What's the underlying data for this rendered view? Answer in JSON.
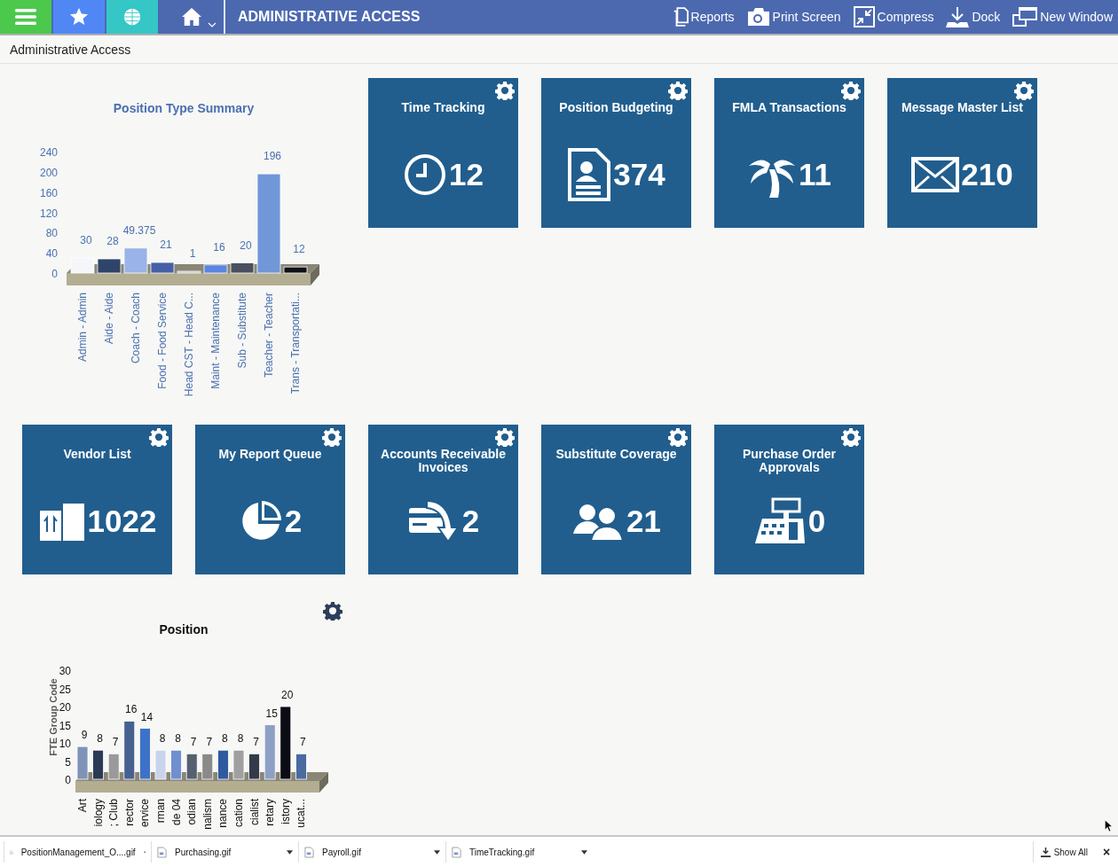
{
  "app_bar": {
    "title": "ADMINISTRATIVE ACCESS",
    "actions": [
      {
        "label": "Reports"
      },
      {
        "label": "Print Screen"
      },
      {
        "label": "Compress"
      },
      {
        "label": "Dock"
      },
      {
        "label": "New Window"
      }
    ]
  },
  "breadcrumb": "Administrative Access",
  "widgets": [
    {
      "kind": "chart",
      "settings": false,
      "chart_data": {
        "type": "bar",
        "title": "Position Type Summary",
        "categories": [
          "Admin - Admin",
          "Aide - Aide",
          "Coach - Coach",
          "Food - Food Service",
          "Head CST - Head C...",
          "Maint - Maintenance",
          "Sub - Substitute",
          "Teacher - Teacher",
          "Trans - Transportati..."
        ],
        "values": [
          30,
          28,
          49.375,
          21,
          1,
          16,
          20,
          196,
          12
        ],
        "ylim": [
          0,
          240
        ],
        "yticks": [
          0,
          40,
          80,
          120,
          160,
          200,
          240
        ],
        "data_labels": true
      }
    },
    {
      "kind": "tile",
      "title": "Time Tracking",
      "count": "12"
    },
    {
      "kind": "tile",
      "title": "Position Budgeting",
      "count": "374"
    },
    {
      "kind": "tile",
      "title": "FMLA Transactions",
      "count": "11"
    },
    {
      "kind": "tile",
      "title": "Message Master List",
      "count": "210"
    },
    {
      "kind": "tile",
      "title": "Vendor List",
      "count": "1022"
    },
    {
      "kind": "tile",
      "title": "My Report Queue",
      "count": "2"
    },
    {
      "kind": "tile",
      "title": "Accounts Receivable Invoices",
      "count": "2"
    },
    {
      "kind": "tile",
      "title": "Substitute Coverage",
      "count": "21"
    },
    {
      "kind": "tile",
      "title": "Purchase Order Approvals",
      "count": "0"
    },
    {
      "kind": "chart",
      "settings": true,
      "chart_data": {
        "type": "bar",
        "title": "Position",
        "ylabel": "FTE Group Code",
        "categories": [
          "Art",
          "iology",
          "; Club",
          "rector",
          "ervice",
          "rman",
          "de 04",
          "odian",
          "nalism",
          "nance",
          "cation",
          "cialist",
          "retary",
          "istory",
          "ucat..."
        ],
        "values": [
          9,
          8,
          7,
          16,
          14,
          8,
          8,
          7,
          7,
          8,
          8,
          7,
          15,
          20,
          7
        ],
        "ylim": [
          0,
          30
        ],
        "yticks": [
          0,
          5,
          10,
          15,
          20,
          25,
          30
        ],
        "data_labels": true
      }
    }
  ],
  "downloads": [
    {
      "name": "PositionManagement_O....gif"
    },
    {
      "name": "Purchasing.gif"
    },
    {
      "name": "Payroll.gif"
    },
    {
      "name": "TimeTracking.gif"
    }
  ],
  "download_bar": {
    "show_all": "Show All",
    "close": "×"
  }
}
